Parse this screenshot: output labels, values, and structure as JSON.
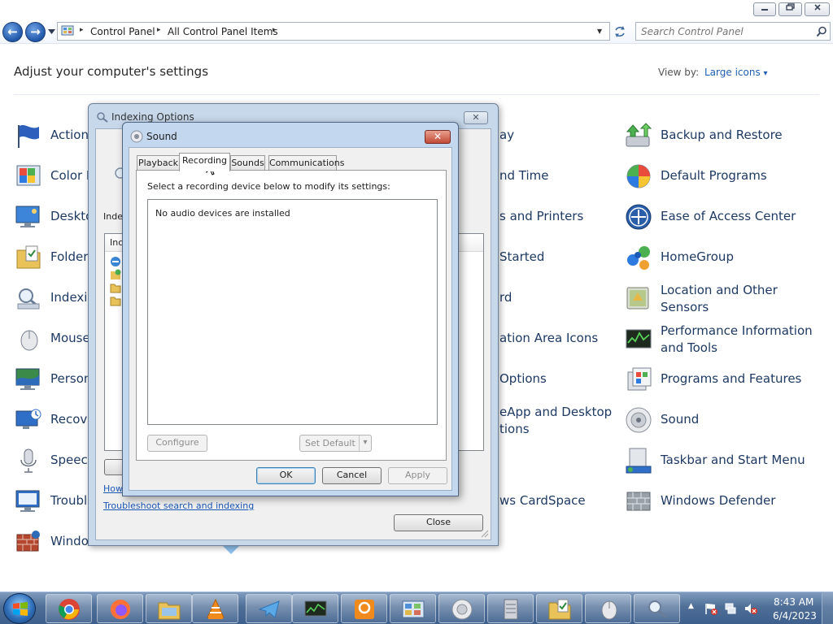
{
  "window": {
    "minimize_icon": "minimize-icon",
    "maximize_icon": "maximize-icon",
    "close_icon": "close-icon"
  },
  "address": {
    "crumbs": [
      "Control Panel",
      "All Control Panel Items"
    ],
    "separator": "▸",
    "dropdown_glyph": "▾",
    "search_placeholder": "Search Control Panel"
  },
  "content": {
    "heading": "Adjust your computer's settings",
    "view_by_label": "View by:",
    "view_by_value": "Large icons",
    "view_by_arrow": "▾",
    "col1_items": [
      "Action",
      "Color M",
      "Deskto",
      "Folder",
      "Indexin",
      "Mouse",
      "Person",
      "Recove",
      "Speech",
      "Troubl",
      "Windo"
    ],
    "col3_items": [
      "ay",
      "nd Time",
      "s and Printers",
      "Started",
      "rd",
      "ation Area Icons",
      "Options",
      "eApp and Desktop\ntions",
      "ws CardSpace"
    ],
    "col3_second": {
      "line1": "eApp and Desktop",
      "line2": "tions"
    },
    "col4_items": [
      {
        "label": "Backup and Restore",
        "icon": "backup-icon"
      },
      {
        "label": "Default Programs",
        "icon": "default-programs-icon"
      },
      {
        "label": "Ease of Access Center",
        "icon": "ease-of-access-icon"
      },
      {
        "label": "HomeGroup",
        "icon": "homegroup-icon"
      },
      {
        "label": "Location and Other Sensors",
        "icon": "location-sensors-icon"
      },
      {
        "label": "Performance Information and Tools",
        "icon": "performance-icon"
      },
      {
        "label": "Programs and Features",
        "icon": "programs-features-icon"
      },
      {
        "label": "Sound",
        "icon": "sound-icon"
      },
      {
        "label": "Taskbar and Start Menu",
        "icon": "taskbar-icon"
      },
      {
        "label": "Windows Defender",
        "icon": "windows-defender-icon"
      }
    ]
  },
  "indexing": {
    "title": "Indexing Options",
    "close_glyph": "✕",
    "partial_label": "Inde",
    "column_partial": "Inc",
    "link_how": "How",
    "link_troubleshoot": "Troubleshoot search and indexing",
    "close_button": "Close"
  },
  "sound": {
    "title": "Sound",
    "close_glyph": "✕",
    "tabs": [
      "Playback",
      "Recording",
      "Sounds",
      "Communications"
    ],
    "active_tab": "Recording",
    "instruction": "Select a recording device below to modify its settings:",
    "empty_message": "No audio devices are installed",
    "configure": "Configure",
    "set_default": "Set Default",
    "set_default_arrow": "▾",
    "ok": "OK",
    "cancel": "Cancel",
    "apply": "Apply"
  },
  "taskbar": {
    "time": "8:43 AM",
    "date": "6/4/2023",
    "tray_arrow": "▲",
    "pinned": [
      "chrome-icon",
      "firefox-icon",
      "explorer-icon",
      "vlc-icon",
      "telegram-icon",
      "network-monitor-icon",
      "pdf-editor-icon",
      "control-panel-icon",
      "speaker-app-icon",
      "server-icon",
      "folder-options-icon",
      "mouse-icon",
      "indexing-icon"
    ]
  }
}
